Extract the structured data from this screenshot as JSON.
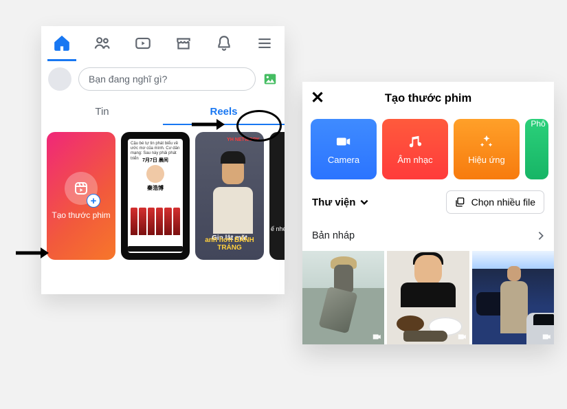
{
  "left": {
    "nav": {
      "items": [
        "home",
        "friends",
        "watch",
        "marketplace",
        "notifications",
        "menu"
      ],
      "active": "home"
    },
    "composer": {
      "placeholder": "Bạn đang nghĩ gì?"
    },
    "tabs": {
      "tin": "Tin",
      "reels": "Reels",
      "active": "reels"
    },
    "reels": {
      "create_label": "Tạo thước phim",
      "card2": {
        "top_text": "Cậu bé tự tin phát biểu về ước mơ của mình. Cư dân mạng: Sau này phải phát triển",
        "date": "7月7日 晨间",
        "name": "秦浩博"
      },
      "card3": {
        "tag": "YH NETWORK",
        "line1": "Gin lật mặt",
        "line2": "anh hơn BÁNH TRÁNG"
      },
      "card4": {
        "text": "ế nhé"
      }
    }
  },
  "right": {
    "title": "Tạo thước phim",
    "tiles": {
      "camera": "Camera",
      "music": "Âm nhạc",
      "effect": "Hiệu ứng",
      "green": "Phô"
    },
    "library_label": "Thư viện",
    "multi_select": "Chọn nhiều file",
    "drafts": "Bản nháp"
  }
}
